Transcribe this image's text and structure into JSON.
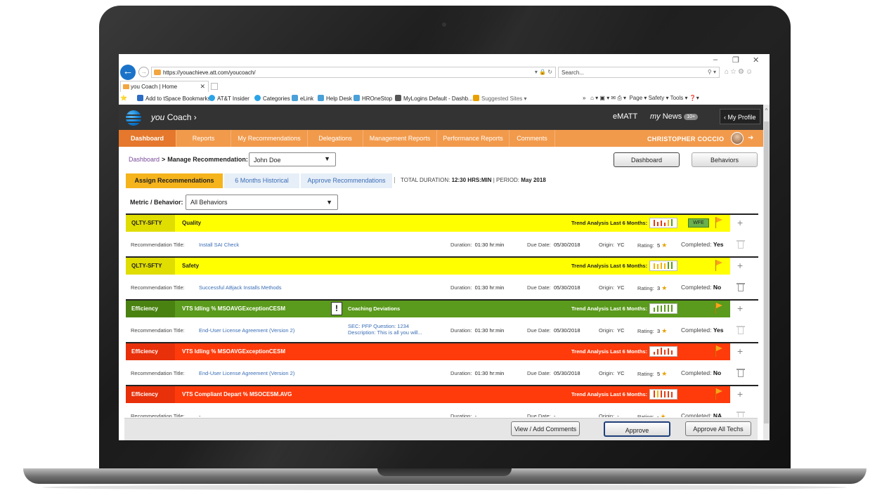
{
  "browser": {
    "url": "https://youachieve.att.com/youcoach/",
    "search_placeholder": "Search...",
    "tab_title": "you Coach | Home",
    "favorites": [
      "Add to tSpace Bookmarks",
      "AT&T Insider",
      "Categories",
      "eLink",
      "Help Desk",
      "HROneStop",
      "MyLogins Default - Dashb...",
      "Suggested Sites ▾"
    ],
    "command_bar": "Page ▾   Safety ▾   Tools ▾"
  },
  "app": {
    "title_italic": "you",
    "title_rest": " Coach ›",
    "ematt": "eMATT",
    "mynews_italic": "my",
    "mynews_rest": " News",
    "news_count": "10+",
    "profile": "‹ My Profile"
  },
  "nav": {
    "items": [
      "Dashboard",
      "Reports",
      "My Recommendations",
      "Delegations",
      "Management Reports",
      "Performance Reports",
      "Comments"
    ],
    "user_name": "CHRISTOPHER COCCIO"
  },
  "page": {
    "breadcrumb_link": "Dashboard",
    "breadcrumb_sep": ">",
    "breadcrumb_current": "Manage Recommendation:",
    "person_select": "John Doe",
    "dashboard_button": "Dashboard",
    "behaviors_button": "Behaviors",
    "tabs": [
      "Assign Recommendations",
      "6 Months Historical",
      "Approve Recommendations"
    ],
    "duration_label": "TOTAL DURATION:",
    "duration_value": "12:30 HRS:MIN",
    "period_label": "| PERIOD:",
    "period_value": "May 2018",
    "metric_label": "Metric / Behavior:",
    "metric_select": "All Behaviors"
  },
  "labels": {
    "trend": "Trend Analysis Last 6 Months:",
    "rec_title": "Recommendation Title:",
    "duration": "Duration:",
    "due": "Due Date:",
    "origin": "Origin:",
    "rating": "Rating:",
    "completed": "Completed:",
    "wfe": "WFE"
  },
  "recommendations": [
    {
      "category": "QLTY-SFTY",
      "name": "Quality",
      "title": "Install SAI Check",
      "duration": "01:30 hr:min",
      "due": "05/30/2018",
      "origin": "YC",
      "rating": "5",
      "completed": "Yes"
    },
    {
      "category": "QLTY-SFTY",
      "name": "Safety",
      "title": "Successful ABjack Installs Methods",
      "duration": "01:30 hr:min",
      "due": "05/30/2018",
      "origin": "YC",
      "rating": "3",
      "completed": "No"
    },
    {
      "category": "Efficiency",
      "name": "VTS Idling %  MSOAVGExceptionCESM",
      "title": "End-User License Agreement (Version 2)",
      "duration": "01:30 hr:min",
      "due": "05/30/2018",
      "origin": "YC",
      "rating": "3",
      "completed": "Yes",
      "coaching": "Coaching Deviations",
      "sec_line1": "SEC: PFP Question: 1234",
      "sec_line2": "Description: This is all you will..."
    },
    {
      "category": "Efficiency",
      "name": "VTS Idling %  MSOAVGExceptionCESM",
      "title": "End-User License Agreement (Version 2)",
      "duration": "01:30 hr:min",
      "due": "05/30/2018",
      "origin": "YC",
      "rating": "5",
      "completed": "No"
    },
    {
      "category": "Efficiency",
      "name": "VTS Compliant Depart %  MSOCESM.AVG",
      "title": "-",
      "duration": "-",
      "due": "-",
      "origin": "-",
      "rating": "-",
      "completed": "NA"
    }
  ],
  "footer": {
    "comments_button": "View / Add Comments",
    "approve_button": "Approve",
    "approve_all_button": "Approve All Techs"
  },
  "colors": {
    "nav": "#f29a4b",
    "yellow_row": "#ffff00",
    "yellow_cat": "#e0dd00",
    "green_row": "#5a9a1c",
    "green_cat": "#4a8212",
    "red_row": "#ff3b0b",
    "red_cat": "#e8300a"
  }
}
